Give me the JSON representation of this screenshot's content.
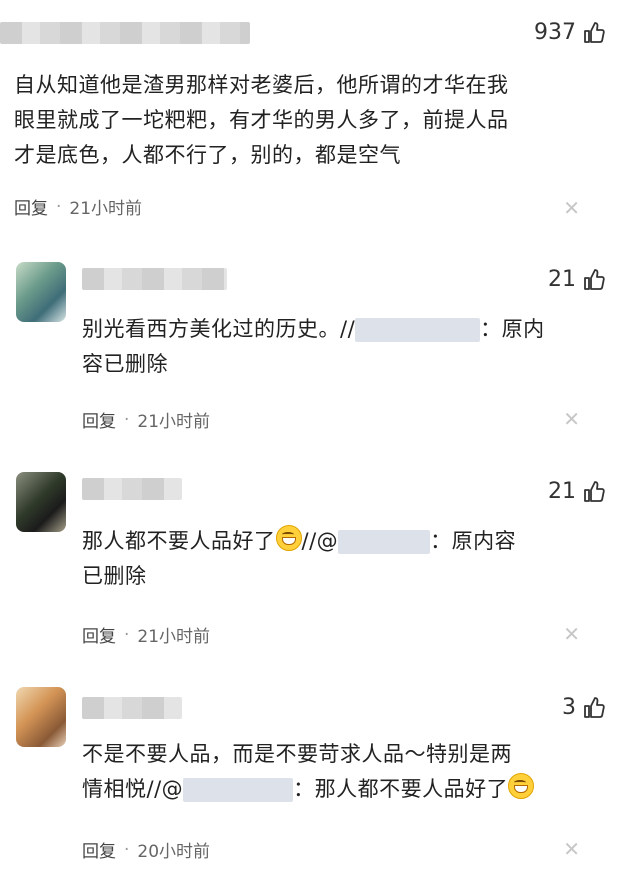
{
  "comments": [
    {
      "likes": "937",
      "text": "自从知道他是渣男那样对老婆后，他所谓的才华在我眼里就成了一坨粑粑，有才华的男人多了，前提人品才是底色，人都不行了，别的，都是空气",
      "lines": [
        "自从知道他是渣男那样对老婆后，他所谓的才华在我",
        "眼里就成了一坨粑粑，有才华的男人多了，前提人品",
        "才是底色，人都不行了，别的，都是空气"
      ],
      "reply_label": "回复",
      "time": "21小时前"
    },
    {
      "likes": "21",
      "line1_prefix": "别光看西方美化过的历史。//",
      "line1_suffix": "：原内",
      "line2": "容已删除",
      "reply_label": "回复",
      "time": "21小时前"
    },
    {
      "likes": "21",
      "line1_prefix": "那人都不要人品好了",
      "line1_mid": "//@",
      "line1_suffix": "：原内容",
      "line2": "已删除",
      "reply_label": "回复",
      "time": "21小时前"
    },
    {
      "likes": "3",
      "line1": "不是不要人品，而是不要苛求人品～特别是两",
      "line2_prefix": "情相悦//@",
      "line2_suffix": "：那人都不要人品好了",
      "reply_label": "回复",
      "time": "20小时前"
    }
  ],
  "icons": {
    "like": "thumbs-up-icon",
    "close": "close-icon",
    "emoji": "grin-emoji-icon"
  },
  "colors": {
    "text": "#222222",
    "meta": "#666666",
    "close": "#c7c7c7",
    "mask": "#dde1ea"
  }
}
